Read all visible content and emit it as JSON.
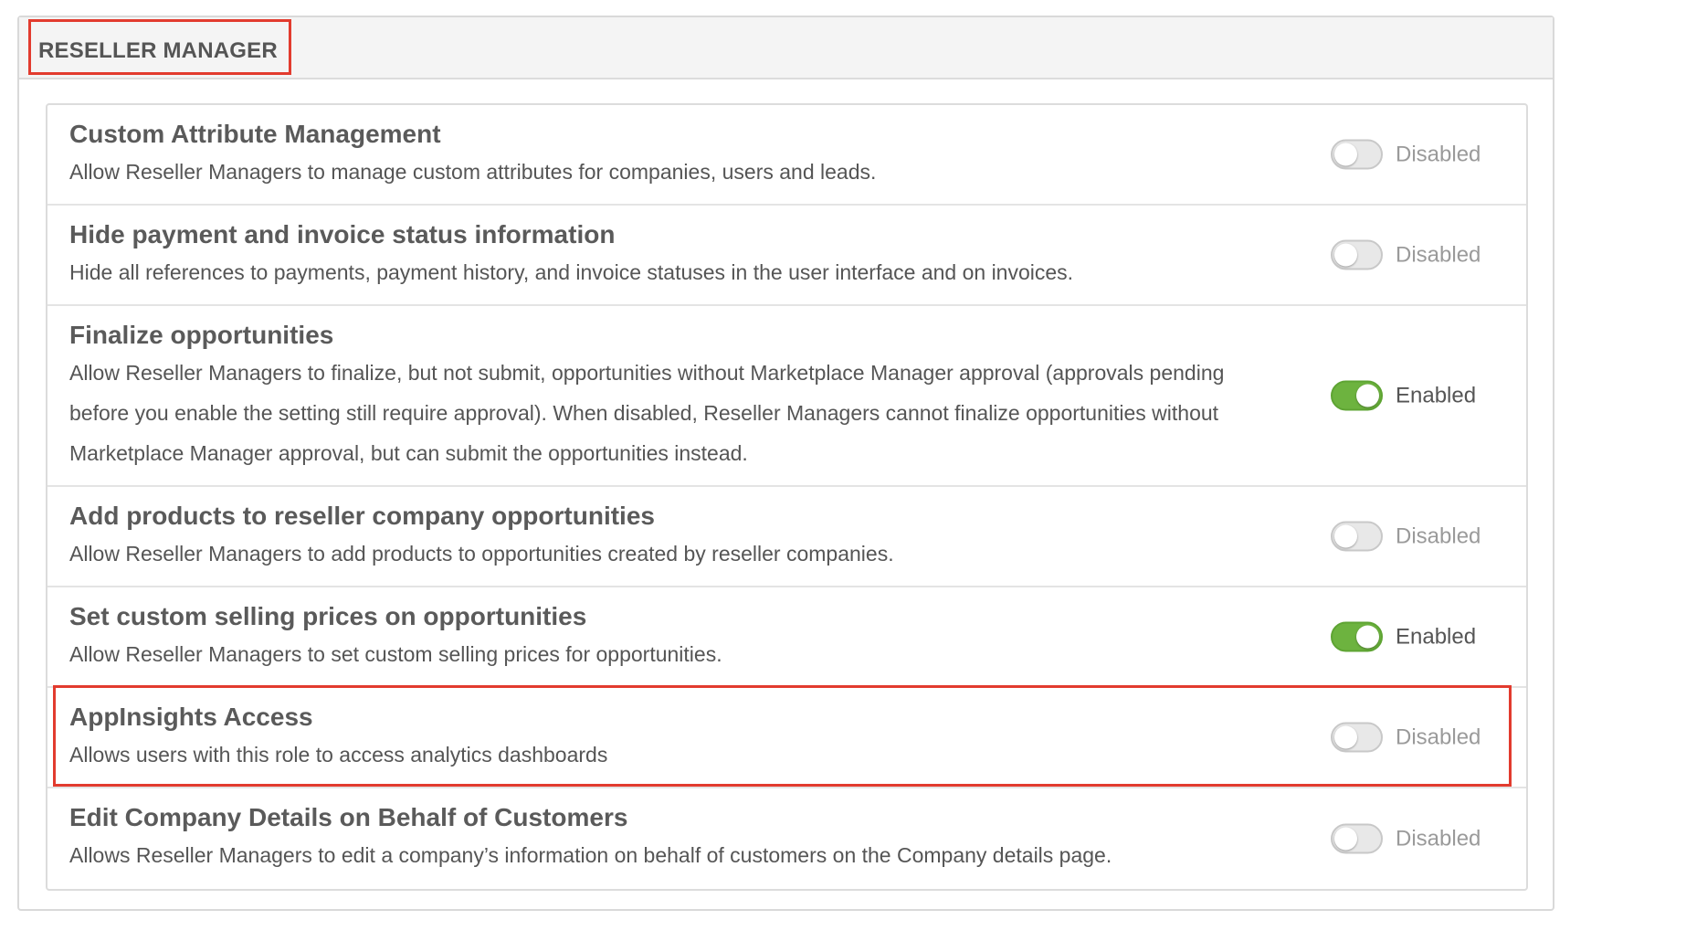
{
  "section": {
    "title": "RESELLER MANAGER"
  },
  "colors": {
    "accent_enabled": "#6db33f",
    "highlight": "#e23b2e"
  },
  "settings": [
    {
      "title": "Custom Attribute Management",
      "description": "Allow Reseller Managers to manage custom attributes for companies, users and leads.",
      "enabled": false,
      "status": "Disabled"
    },
    {
      "title": "Hide payment and invoice status information",
      "description": "Hide all references to payments, payment history, and invoice statuses in the user interface and on invoices.",
      "enabled": false,
      "status": "Disabled"
    },
    {
      "title": "Finalize opportunities",
      "description": "Allow Reseller Managers to finalize, but not submit, opportunities without Marketplace Manager approval (approvals pending before you enable the setting still require approval). When disabled, Reseller Managers cannot finalize opportunities without Marketplace Manager approval, but can submit the opportunities instead.",
      "enabled": true,
      "status": "Enabled"
    },
    {
      "title": "Add products to reseller company opportunities",
      "description": "Allow Reseller Managers to add products to opportunities created by reseller companies.",
      "enabled": false,
      "status": "Disabled"
    },
    {
      "title": "Set custom selling prices on opportunities",
      "description": "Allow Reseller Managers to set custom selling prices for opportunities.",
      "enabled": true,
      "status": "Enabled"
    },
    {
      "title": "AppInsights Access",
      "description": "Allows users with this role to access analytics dashboards",
      "enabled": false,
      "status": "Disabled"
    },
    {
      "title": "Edit Company Details on Behalf of Customers",
      "description": "Allows Reseller Managers to edit a company’s information on behalf of customers on the Company details page.",
      "enabled": false,
      "status": "Disabled"
    }
  ]
}
